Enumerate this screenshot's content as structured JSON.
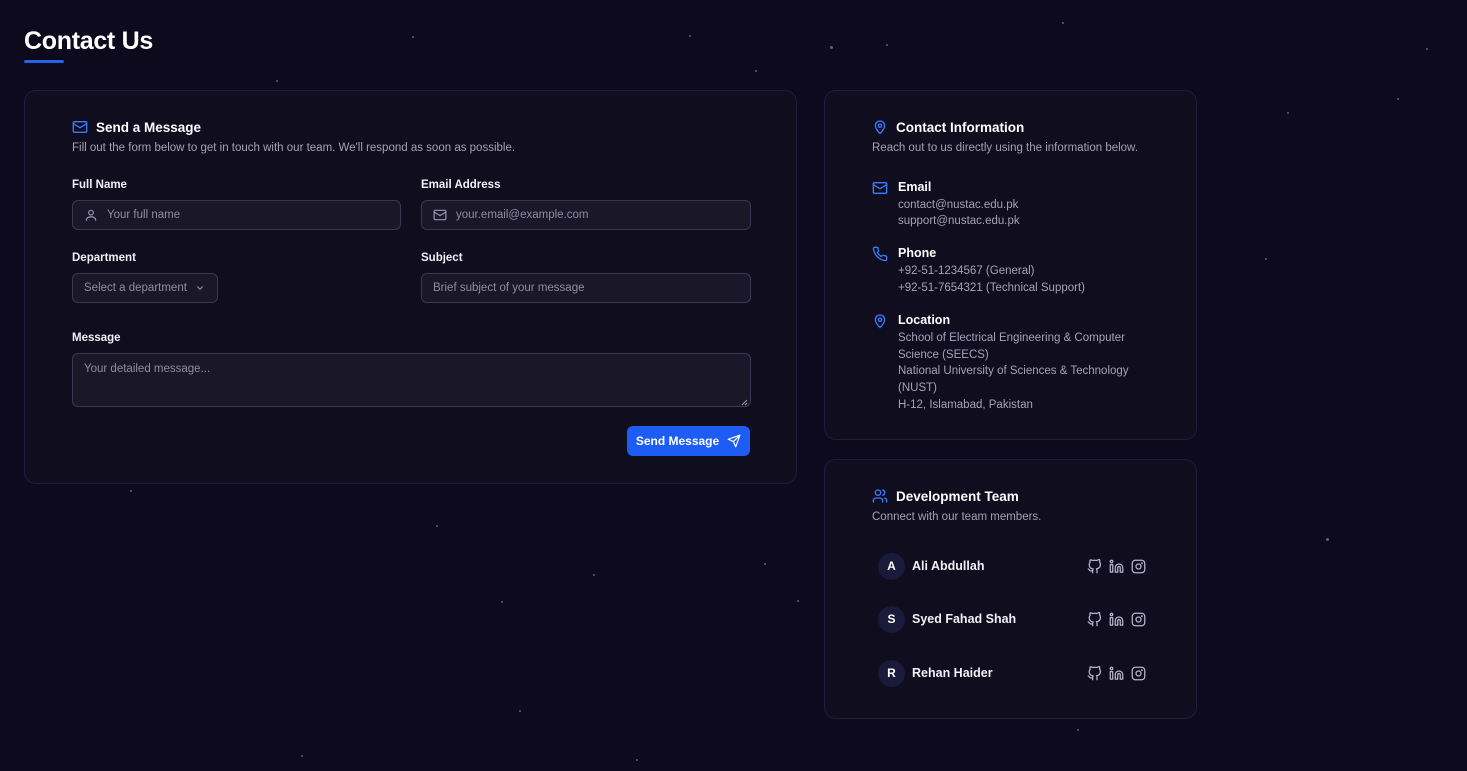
{
  "page": {
    "title": "Contact Us"
  },
  "colors": {
    "accent": "#1d5cf5",
    "background": "#0c0a1c",
    "card": "#0f0d1e"
  },
  "message_form": {
    "title": "Send a Message",
    "icon": "mail-icon",
    "subtitle": "Fill out the form below to get in touch with our team. We'll respond as soon as possible.",
    "full_name": {
      "label": "Full Name",
      "placeholder": "Your full name",
      "icon": "user-icon"
    },
    "email": {
      "label": "Email Address",
      "placeholder": "your.email@example.com",
      "icon": "mail-icon"
    },
    "department": {
      "label": "Department",
      "placeholder": "Select a department",
      "icon": "chevron-down-icon"
    },
    "subject": {
      "label": "Subject",
      "placeholder": "Brief subject of your message"
    },
    "message": {
      "label": "Message",
      "placeholder": "Your detailed message..."
    },
    "submit_label": "Send Message",
    "submit_icon": "send-icon"
  },
  "contact_info": {
    "title": "Contact Information",
    "icon": "map-pin-icon",
    "subtitle": "Reach out to us directly using the information below.",
    "email": {
      "title": "Email",
      "icon": "mail-icon",
      "lines": [
        "contact@nustac.edu.pk",
        "support@nustac.edu.pk"
      ]
    },
    "phone": {
      "title": "Phone",
      "icon": "phone-icon",
      "lines": [
        "+92-51-1234567 (General)",
        "+92-51-7654321 (Technical Support)"
      ]
    },
    "location": {
      "title": "Location",
      "icon": "map-pin-icon",
      "lines": [
        "School of Electrical Engineering & Computer",
        "Science (SEECS)",
        "National University of Sciences & Technology",
        "(NUST)",
        "H-12, Islamabad, Pakistan"
      ]
    }
  },
  "team": {
    "title": "Development Team",
    "icon": "users-icon",
    "subtitle": "Connect with our team members.",
    "members": [
      {
        "initial": "A",
        "name": "Ali Abdullah"
      },
      {
        "initial": "S",
        "name": "Syed Fahad Shah"
      },
      {
        "initial": "R",
        "name": "Rehan Haider"
      }
    ],
    "social_icons": [
      "github-icon",
      "linkedin-icon",
      "instagram-icon"
    ]
  }
}
